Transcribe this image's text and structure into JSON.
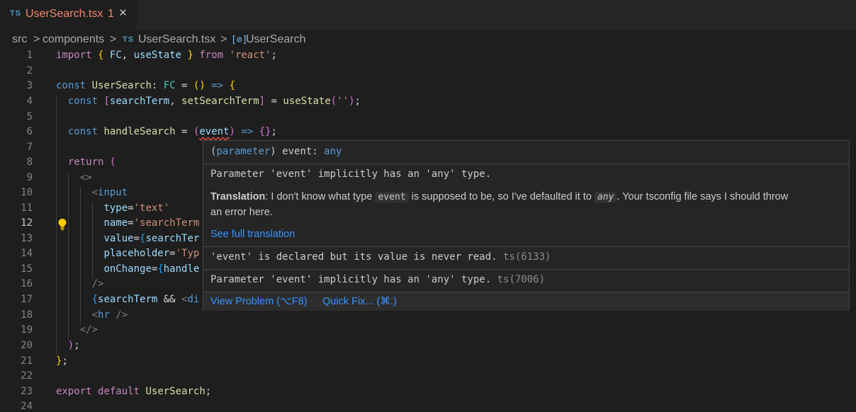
{
  "tab": {
    "lang": "TS",
    "filename": "UserSearch.tsx",
    "problem_count": "1",
    "close": "×"
  },
  "breadcrumb": {
    "folder1": "src",
    "folder2": "components",
    "file_lang": "TS",
    "file": "UserSearch.tsx",
    "symbol": "UserSearch",
    "sep": ">"
  },
  "editor": {
    "line_numbers": [
      "1",
      "2",
      "3",
      "4",
      "5",
      "6",
      "7",
      "8",
      "9",
      "10",
      "11",
      "12",
      "13",
      "14",
      "15",
      "16",
      "17",
      "18",
      "19",
      "20",
      "21",
      "22",
      "23",
      "24"
    ],
    "active_line": "12"
  },
  "hover": {
    "signature": {
      "open": "(",
      "kind": "parameter",
      "close": ")",
      "name": " event: ",
      "type": "any"
    },
    "message1": "Parameter 'event' implicitly has an 'any' type.",
    "translation_label": "Translation",
    "translation_text1": ": I don't know what type ",
    "translation_code1": "event",
    "translation_text2": " is supposed to be, so I've defaulted it to ",
    "translation_code2": "any",
    "translation_text3": ". Your tsconfig file says I should throw",
    "translation_text4": "an error here.",
    "see_full": "See full translation",
    "problem1": "'event' is declared but its value is never read.",
    "problem1_code": "ts(6133)",
    "problem2": "Parameter 'event' implicitly has an 'any' type.",
    "problem2_code": "ts(7006)",
    "view_problem": "View Problem (⌥F8)",
    "quick_fix": "Quick Fix... (⌘.)"
  },
  "colors": {
    "keyword": "#569cd6",
    "control": "#c586c0",
    "function": "#dcdcaa",
    "type": "#4ec9b0",
    "variable": "#9cdcfe",
    "string": "#ce9178",
    "error": "#f14c4c",
    "link": "#3794ff"
  }
}
